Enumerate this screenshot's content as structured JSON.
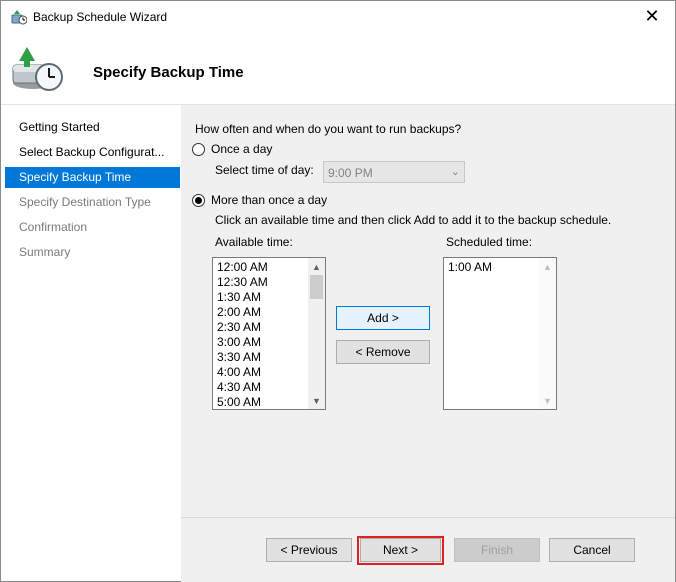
{
  "window": {
    "title": "Backup Schedule Wizard",
    "close_glyph": "✕"
  },
  "header": {
    "title": "Specify Backup Time"
  },
  "sidebar": {
    "items": [
      {
        "label": "Getting Started",
        "state": "normal"
      },
      {
        "label": "Select Backup Configurat...",
        "state": "normal"
      },
      {
        "label": "Specify Backup Time",
        "state": "selected"
      },
      {
        "label": "Specify Destination Type",
        "state": "disabled"
      },
      {
        "label": "Confirmation",
        "state": "disabled"
      },
      {
        "label": "Summary",
        "state": "disabled"
      }
    ]
  },
  "main": {
    "question": "How often and when do you want to run backups?",
    "once_a_day": {
      "label": "Once a day",
      "checked": false
    },
    "select_time_label": "Select time of day:",
    "time_select": {
      "value": "9:00 PM",
      "enabled": false
    },
    "more_than_once": {
      "label": "More than once a day",
      "checked": true
    },
    "instruction": "Click an available time and then click Add to add it to the backup schedule.",
    "available_label": "Available time:",
    "available_times": [
      "12:00 AM",
      "12:30 AM",
      "1:30 AM",
      "2:00 AM",
      "2:30 AM",
      "3:00 AM",
      "3:30 AM",
      "4:00 AM",
      "4:30 AM",
      "5:00 AM"
    ],
    "add_label": "Add >",
    "remove_label": "< Remove",
    "scheduled_label": "Scheduled time:",
    "scheduled_times": [
      "1:00 AM"
    ]
  },
  "footer": {
    "previous": "< Previous",
    "next": "Next >",
    "finish": "Finish",
    "cancel": "Cancel"
  },
  "colors": {
    "selection": "#0078d7",
    "highlight_box": "#e02020",
    "panel_bg": "#f0f0f0"
  },
  "icons": [
    "backup-schedule-icon",
    "close-icon",
    "wizard-header-icon",
    "scroll-up-icon",
    "scroll-down-icon"
  ]
}
